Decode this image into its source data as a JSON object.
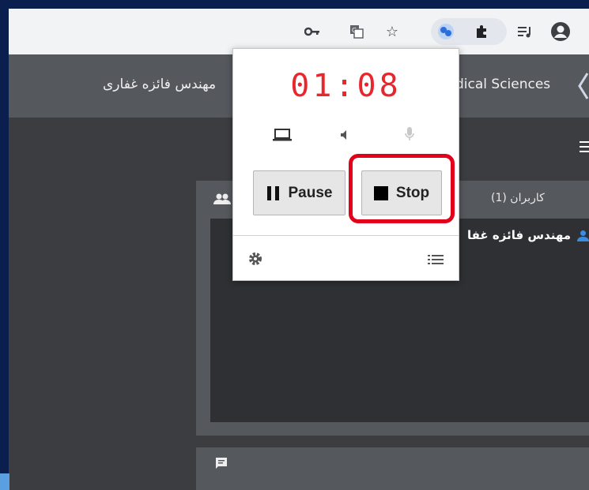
{
  "browser": {
    "toolbar_icons": [
      "key-icon",
      "translate-icon",
      "star-icon",
      "extension-recorder-icon",
      "puzzle-icon",
      "media-queue-icon",
      "account-icon"
    ]
  },
  "app": {
    "presenter_name": "مهندس فائزه غفاری",
    "org_name_partial": "dical Sciences",
    "users_header": "کاربران (1)",
    "user_entry": "مهندس فائزه غفا"
  },
  "recorder_popup": {
    "timer": "01:08",
    "pause_label": "Pause",
    "stop_label": "Stop",
    "source_icons": [
      "laptop-icon",
      "speaker-icon",
      "microphone-icon"
    ]
  },
  "colors": {
    "timer": "#e8262c",
    "highlight": "#e3001b",
    "frame": "#0b1f4f"
  }
}
